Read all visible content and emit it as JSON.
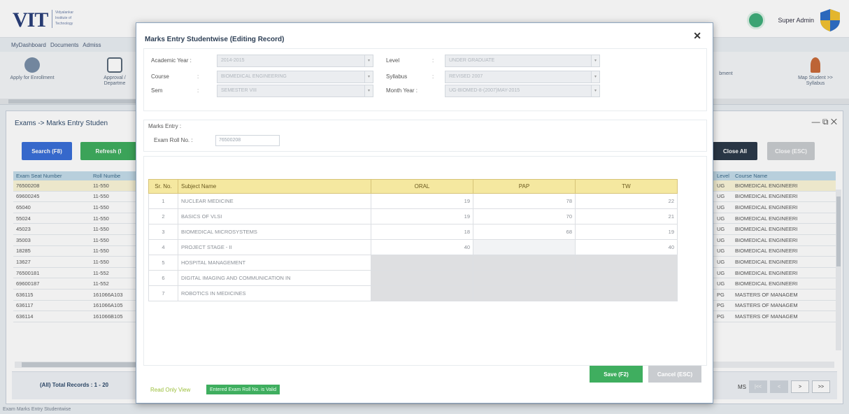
{
  "header": {
    "logo_text": "VIT",
    "logo_sub": "Vidyalankar Institute of Technology",
    "menu": [
      "MyDashboard",
      "Documents",
      "Admiss"
    ],
    "user_name": "Super Admin"
  },
  "ribbon": {
    "items": [
      {
        "label": "Apply for Enrollment",
        "icon": "user-apply-icon"
      },
      {
        "label": "Approval / Departme",
        "icon": "approval-check-icon"
      },
      {
        "label": "bment",
        "icon": "blank"
      },
      {
        "label": "Map Student >> Syllabus",
        "icon": "map-student-icon"
      }
    ]
  },
  "background_panel": {
    "breadcrumb": "Exams -> Marks Entry Studen",
    "search_label": "Search (F8)",
    "refresh_label": "Refresh (I",
    "close_all_label": "Close All",
    "close_esc_label": "Close (ESC)",
    "columns": {
      "exam_seat": "Exam Seat Number",
      "roll": "Roll Numbe",
      "level": "Level",
      "course": "Course Name"
    },
    "rows": [
      {
        "seat": "76500208",
        "roll": "11-550",
        "level": "UG",
        "course": "BIOMEDICAL ENGINEERI"
      },
      {
        "seat": "69600245",
        "roll": "11-550",
        "level": "UG",
        "course": "BIOMEDICAL ENGINEERI"
      },
      {
        "seat": "65040",
        "roll": "11-550",
        "level": "UG",
        "course": "BIOMEDICAL ENGINEERI"
      },
      {
        "seat": "55024",
        "roll": "11-550",
        "level": "UG",
        "course": "BIOMEDICAL ENGINEERI"
      },
      {
        "seat": "45023",
        "roll": "11-550",
        "level": "UG",
        "course": "BIOMEDICAL ENGINEERI"
      },
      {
        "seat": "35003",
        "roll": "11-550",
        "level": "UG",
        "course": "BIOMEDICAL ENGINEERI"
      },
      {
        "seat": "18285",
        "roll": "11-550",
        "level": "UG",
        "course": "BIOMEDICAL ENGINEERI"
      },
      {
        "seat": "13627",
        "roll": "11-550",
        "level": "UG",
        "course": "BIOMEDICAL ENGINEERI"
      },
      {
        "seat": "76500181",
        "roll": "11-552",
        "level": "UG",
        "course": "BIOMEDICAL ENGINEERI"
      },
      {
        "seat": "69600187",
        "roll": "11-552",
        "level": "UG",
        "course": "BIOMEDICAL ENGINEERI"
      },
      {
        "seat": "636115",
        "roll": "161066A103",
        "level": "PG",
        "course": "MASTERS OF MANAGEM"
      },
      {
        "seat": "636117",
        "roll": "161066A105",
        "level": "PG",
        "course": "MASTERS OF MANAGEM"
      },
      {
        "seat": "636114",
        "roll": "161066B105",
        "level": "PG",
        "course": "MASTERS OF MANAGEM"
      }
    ],
    "total_records": "(All) Total Records : 1 - 20",
    "pager_prefix": "MS"
  },
  "status_bar": "Exam  Marks Entry Studentwise",
  "modal": {
    "title": "Marks Entry Studentwise (Editing Record)",
    "form": {
      "academic_year_label": "Academic Year :",
      "academic_year_value": "2014-2015",
      "course_label": "Course",
      "course_value": "BIOMEDICAL ENGINEERING",
      "sem_label": "Sem",
      "sem_value": "SEMESTER VIII",
      "level_label": "Level",
      "level_value": "UNDER GRADUATE",
      "syllabus_label": "Syllabus",
      "syllabus_value": "REVISED 2007",
      "month_year_label": "Month Year :",
      "month_year_value": "UG-BIOMED-8-(2007)MAY-2015"
    },
    "marks_entry_label": "Marks Entry :",
    "exam_roll_label": "Exam Roll No. :",
    "exam_roll_value": "76500208",
    "table": {
      "headers": {
        "sr": "Sr. No.",
        "subject": "Subject Name",
        "oral": "ORAL",
        "pap": "PAP",
        "tw": "TW"
      },
      "rows": [
        {
          "sr": "1",
          "subject": "NUCLEAR MEDICINE",
          "oral": "19",
          "pap": "78",
          "tw": "22"
        },
        {
          "sr": "2",
          "subject": "BASICS OF VLSI",
          "oral": "19",
          "pap": "70",
          "tw": "21"
        },
        {
          "sr": "3",
          "subject": "BIOMEDICAL MICROSYSTEMS",
          "oral": "18",
          "pap": "68",
          "tw": "19"
        },
        {
          "sr": "4",
          "subject": "PROJECT STAGE - II",
          "oral": "40",
          "pap": "",
          "tw": "40"
        },
        {
          "sr": "5",
          "subject": "HOSPITAL MANAGEMENT",
          "oral": "",
          "pap": "",
          "tw": ""
        },
        {
          "sr": "6",
          "subject": "DIGITAL IMAGING AND COMMUNICATION IN",
          "oral": "",
          "pap": "",
          "tw": ""
        },
        {
          "sr": "7",
          "subject": "ROBOTICS IN MEDICINES",
          "oral": "",
          "pap": "",
          "tw": ""
        }
      ]
    },
    "save_label": "Save (F2)",
    "cancel_label": "Cancel (ESC)",
    "read_only_label": "Read Only View",
    "valid_label": "Entered Exam Roll No. is Valid"
  },
  "colors": {
    "accent_blue": "#3a6fd8",
    "accent_green": "#3fae5f",
    "header_yellow": "#f5e8a0",
    "grid_header": "#c4dcea"
  }
}
